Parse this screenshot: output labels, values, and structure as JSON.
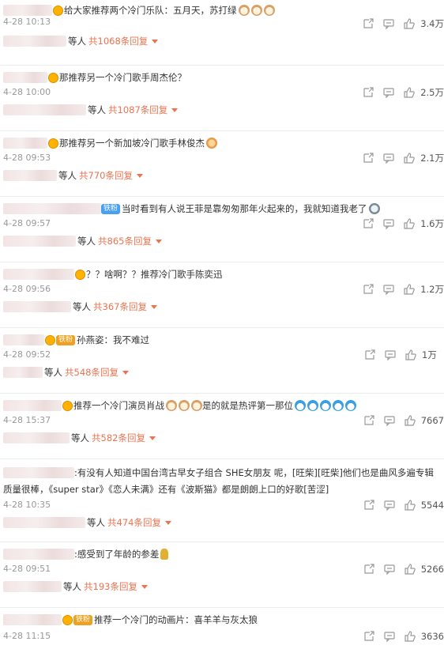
{
  "comments": [
    {
      "text": "给大家推荐两个冷门乐队：五月天，苏打绿",
      "time": "4-28 10:13",
      "likes": "3.4万",
      "replies_who": "等人",
      "replies_count": "共1068条回复",
      "emoji_after": [
        "cat-emoji",
        "cat-emoji",
        "cat-emoji"
      ]
    },
    {
      "text": "那推荐另一个冷门歌手周杰伦？",
      "time": "4-28 10:00",
      "likes": "2.5万",
      "replies_who": "等人",
      "replies_count": "共1087条回复"
    },
    {
      "text": "那推荐另一个新加坡冷门歌手林俊杰",
      "time": "4-28 09:53",
      "likes": "2.1万",
      "replies_who": "等人",
      "replies_count": "共770条回复"
    },
    {
      "badge": "铁粉",
      "text": "当时看到有人说王菲是靠匆匆那年火起来的，我就知道我老了",
      "time": "4-28 09:57",
      "likes": "1.6万",
      "replies_who": "等人",
      "replies_count": "共865条回复"
    },
    {
      "text": "？？啥啊？？推荐冷门歌手陈奕迅",
      "time": "4-28 09:56",
      "likes": "1.2万",
      "replies_who": "等人",
      "replies_count": "共367条回复"
    },
    {
      "badge": "铁粉",
      "text": "孙燕姿：我不难过",
      "time": "4-28 09:52",
      "likes": "1万",
      "replies_who": "等人",
      "replies_count": "共548条回复"
    },
    {
      "text": "推荐一个冷门演员肖战",
      "text2": "是的就是热评第一那位",
      "time": "4-28 15:37",
      "likes": "7667",
      "replies_who": "等人",
      "replies_count": "共582条回复"
    },
    {
      "text": ":有没有人知道中国台湾古早女子组合 SHE女朋友 呢，[旺柴][旺柴]他们也是曲风多遍专辑质量很棒，《super star》《恋人未满》还有《波斯猫》都是朗朗上口的好歌[苦涩]",
      "time": "4-28 10:35",
      "likes": "5544",
      "replies_who": "等人",
      "replies_count": "共474条回复"
    },
    {
      "text": ":感受到了年龄的参差",
      "time": "4-28 09:51",
      "likes": "5266",
      "replies_who": "等人",
      "replies_count": "共193条回复"
    },
    {
      "badge": "铁粉",
      "text": "推荐一个冷门的动画片：喜羊羊与灰太狼",
      "time": "4-28 11:15",
      "likes": "3636"
    }
  ]
}
